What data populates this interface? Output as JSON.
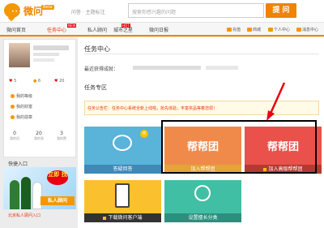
{
  "header": {
    "brand": "微问",
    "beta": "Beta",
    "slogan": "问答 · 主题标注",
    "search_placeholder": "搜索你感兴趣的问题",
    "search_button": "提 问"
  },
  "nav": {
    "items": [
      "微问首页",
      "任务中心",
      "私人顾问",
      "城市之星",
      "微问日报"
    ],
    "active": "任务中心",
    "new_tag": "NEW",
    "hot_tag": "HOT",
    "utils": [
      "充值",
      "商城",
      "个人中心",
      "消息中心"
    ]
  },
  "sidebar": {
    "stats": [
      "5",
      "6",
      "20"
    ],
    "list": [
      "我的等级",
      "我的财富",
      "我的勋章"
    ],
    "counts": [
      {
        "value": "0",
        "label": "我的问"
      },
      {
        "value": "20",
        "label": "我的答"
      },
      {
        "value": "3",
        "label": "我的赞"
      }
    ],
    "entry_title": "快捷入口",
    "ad_banner": "立即 找",
    "ad_text": "私人顾问",
    "link": "北京私人顾问入口"
  },
  "main": {
    "title": "任务中心",
    "recent": "最近获得成就：",
    "zone_title": "任务专区",
    "notice_label": "任务公告栏：",
    "notice_text": "任务中心系统全新上线啦，抢先体验，丰富奖品等着您领！",
    "tiles": [
      {
        "caption": "答疑回答",
        "locked": false
      },
      {
        "caption": "加入帮帮团",
        "locked": false,
        "art": "帮帮团"
      },
      {
        "caption": "加入高级帮帮团",
        "locked": true,
        "art": "帮帮团"
      },
      {
        "caption": "下载微问客户端",
        "locked": true
      },
      {
        "caption": "设置擅长分类",
        "locked": false
      }
    ],
    "t1_badge": "奖"
  },
  "colors": {
    "accent": "#f08300",
    "highlight_border": "#000000",
    "notice_red": "#e8380d"
  }
}
